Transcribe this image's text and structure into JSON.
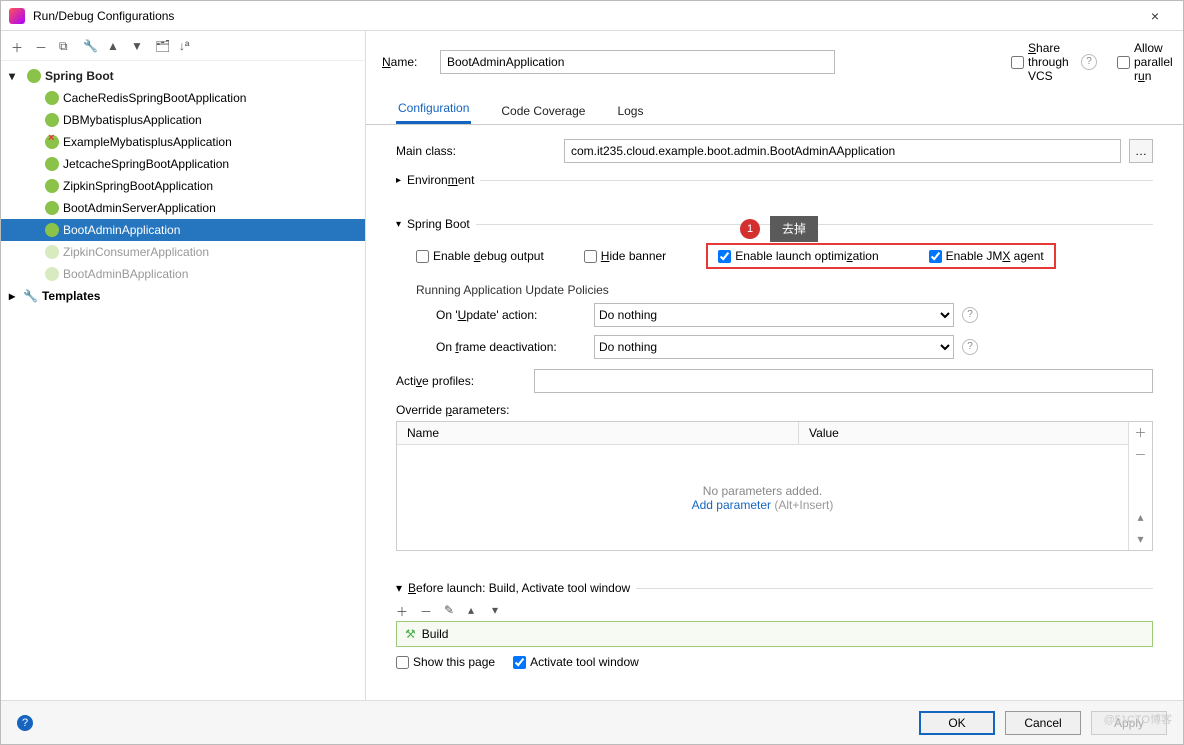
{
  "title": "Run/Debug Configurations",
  "name_label": "Name:",
  "name_value": "BootAdminApplication",
  "share_vcs": "Share through VCS",
  "allow_parallel": "Allow parallel run",
  "tree": {
    "root": "Spring Boot",
    "items": [
      {
        "label": "CacheRedisSpringBootApplication",
        "dim": false
      },
      {
        "label": "DBMybatisplusApplication",
        "dim": false
      },
      {
        "label": "ExampleMybatisplusApplication",
        "dim": false,
        "err": true
      },
      {
        "label": "JetcacheSpringBootApplication",
        "dim": false
      },
      {
        "label": "ZipkinSpringBootApplication",
        "dim": false
      },
      {
        "label": "BootAdminServerApplication",
        "dim": false
      },
      {
        "label": "BootAdminApplication",
        "dim": false,
        "selected": true
      },
      {
        "label": "ZipkinConsumerApplication",
        "dim": true
      },
      {
        "label": "BootAdminBApplication",
        "dim": true
      }
    ],
    "templates": "Templates"
  },
  "tabs": {
    "configuration": "Configuration",
    "coverage": "Code Coverage",
    "logs": "Logs"
  },
  "form": {
    "main_class_label": "Main class:",
    "main_class_value": "com.it235.cloud.example.boot.admin.BootAdminAApplication",
    "environment": "Environment",
    "spring_boot": "Spring Boot",
    "enable_debug": "Enable debug output",
    "hide_banner": "Hide banner",
    "enable_launch_opt": "Enable launch optimization",
    "enable_jmx": "Enable JMX agent",
    "policies_title": "Running Application Update Policies",
    "on_update": "On 'Update' action:",
    "on_update_value": "Do nothing",
    "on_frame": "On frame deactivation:",
    "on_frame_value": "Do nothing",
    "active_profiles": "Active profiles:",
    "override_params": "Override parameters:",
    "col_name": "Name",
    "col_value": "Value",
    "no_params": "No parameters added.",
    "add_param": "Add parameter",
    "add_param_hint": "(Alt+Insert)"
  },
  "callout": {
    "num": "1",
    "label": "去掉"
  },
  "before_launch": {
    "title": "Before launch: Build, Activate tool window",
    "build": "Build",
    "show_this_page": "Show this page",
    "activate_tool": "Activate tool window"
  },
  "footer": {
    "ok": "OK",
    "cancel": "Cancel",
    "apply": "Apply"
  },
  "watermark": "@51CTO博客"
}
